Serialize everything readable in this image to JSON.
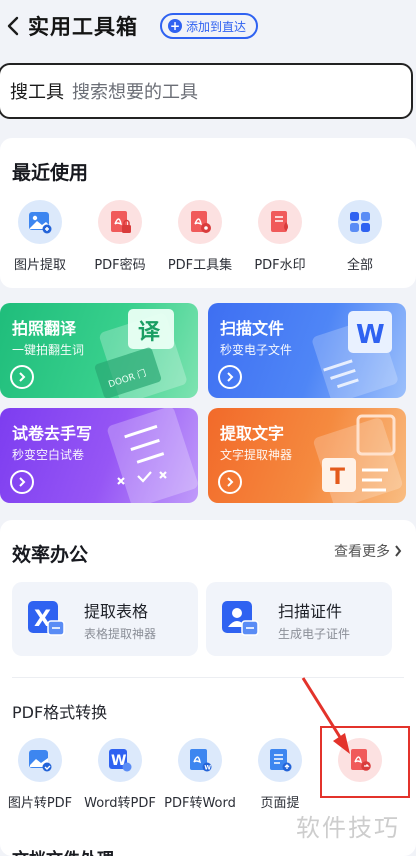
{
  "header": {
    "title": "实用工具箱",
    "add_label": "添加到直达"
  },
  "search": {
    "label": "搜工具",
    "placeholder": "搜索想要的工具"
  },
  "recent": {
    "title": "最近使用",
    "items": [
      {
        "label": "图片提取",
        "icon": "image-extract-icon"
      },
      {
        "label": "PDF密码",
        "icon": "pdf-lock-icon"
      },
      {
        "label": "PDF工具集",
        "icon": "pdf-tools-icon"
      },
      {
        "label": "PDF水印",
        "icon": "pdf-watermark-icon"
      },
      {
        "label": "全部",
        "icon": "grid-icon"
      }
    ]
  },
  "features": [
    {
      "title": "拍照翻译",
      "subtitle": "一键拍翻生词",
      "deco_word": "译",
      "deco_text": "DOOR 门"
    },
    {
      "title": "扫描文件",
      "subtitle": "秒变电子文件",
      "deco_word": "W"
    },
    {
      "title": "试卷去手写",
      "subtitle": "秒变空白试卷"
    },
    {
      "title": "提取文字",
      "subtitle": "文字提取神器",
      "deco_word": "T"
    }
  ],
  "office": {
    "title": "效率办公",
    "more_label": "查看更多",
    "cards": [
      {
        "title": "提取表格",
        "subtitle": "表格提取神器"
      },
      {
        "title": "扫描证件",
        "subtitle": "生成电子证件"
      }
    ]
  },
  "pdf_convert": {
    "title": "PDF格式转换",
    "items": [
      {
        "label": "图片转PDF"
      },
      {
        "label": "Word转PDF"
      },
      {
        "label": "PDF转Word"
      },
      {
        "label": "页面提"
      },
      {
        "label": ""
      }
    ]
  },
  "next_section": {
    "title": "文档文件处理"
  },
  "watermark": "软件技巧",
  "colors": {
    "accent": "#2f62f1",
    "annotation": "#e3332b"
  }
}
